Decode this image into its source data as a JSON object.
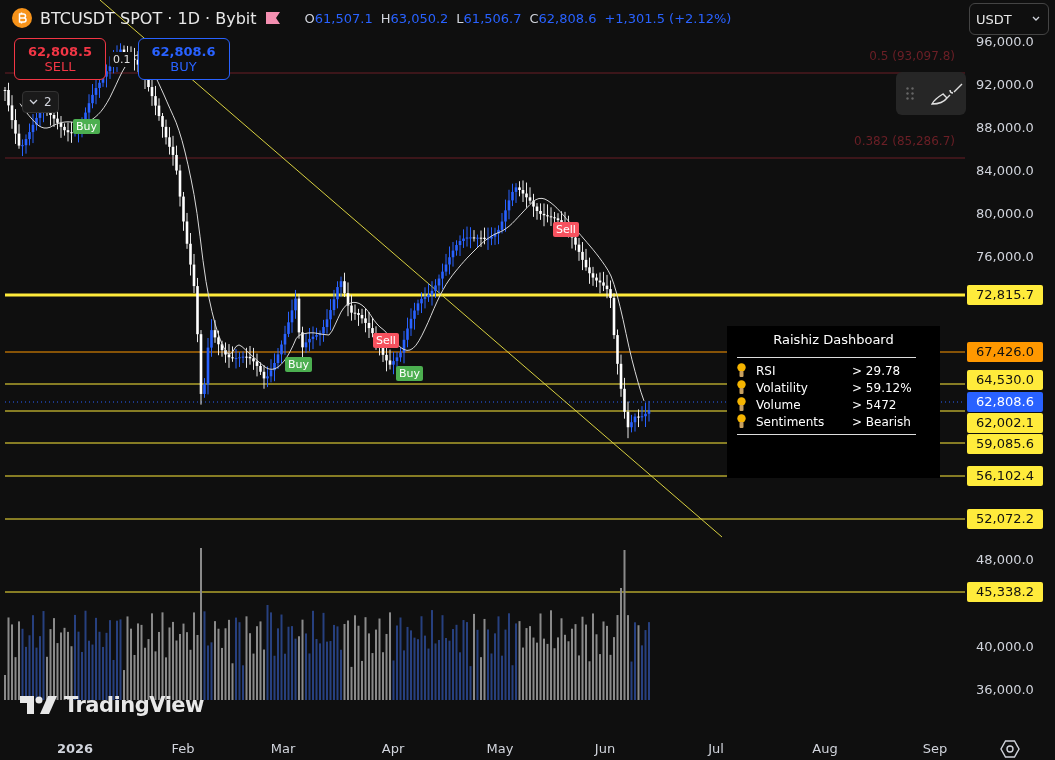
{
  "header": {
    "symbol": "BTCUSDT SPOT · 1D · Bybit",
    "ohlc": [
      {
        "key": "O",
        "value": "61,507.1"
      },
      {
        "key": "H",
        "value": "63,050.2"
      },
      {
        "key": "L",
        "value": "61,506.7"
      },
      {
        "key": "C",
        "value": "62,808.6"
      }
    ],
    "change": "+1,301.5 (+2.12%)"
  },
  "currency_select": {
    "value": "USDT"
  },
  "trade_buttons": [
    {
      "kind": "sell",
      "price": "62,808.5",
      "label": "SELL"
    },
    {
      "kind": "buy",
      "price": "62,808.6",
      "label": "BUY"
    }
  ],
  "quantity": "0.1",
  "indicator_toggle": {
    "count": "2"
  },
  "fib_levels": [
    {
      "label": "0.5 (93,097.8)"
    },
    {
      "label": "0.382 (85,286.7)"
    }
  ],
  "signals": [
    {
      "kind": "buy",
      "label": "Buy"
    },
    {
      "kind": "buy",
      "label": "Buy"
    },
    {
      "kind": "sell",
      "label": "Sell"
    },
    {
      "kind": "buy",
      "label": "Buy"
    },
    {
      "kind": "sell",
      "label": "Sell"
    }
  ],
  "price_scale": [
    "96,000.0",
    "92,000.0",
    "88,000.0",
    "84,000.0",
    "80,000.0",
    "76,000.0",
    "48,000.0",
    "40,000.0",
    "36,000.0"
  ],
  "levels": [
    {
      "label": "72,815.7",
      "kind": "thick",
      "color": "#ffeb3b"
    },
    {
      "label": "67,426.0",
      "kind": "line",
      "color": "#ff9800"
    },
    {
      "label": "64,530.0",
      "kind": "line",
      "color": "#ffeb3b"
    },
    {
      "label": "62,808.6",
      "kind": "current",
      "color": "#2962ff"
    },
    {
      "label": "62,002.1",
      "kind": "line",
      "color": "#ffeb3b"
    },
    {
      "label": "59,085.6",
      "kind": "line",
      "color": "#ffeb3b"
    },
    {
      "label": "56,102.4",
      "kind": "line",
      "color": "#ffeb3b"
    },
    {
      "label": "52,072.2",
      "kind": "line",
      "color": "#ffeb3b"
    },
    {
      "label": "45,338.2",
      "kind": "line",
      "color": "#ffeb3b"
    }
  ],
  "dashboard": {
    "title": "Raishiz Dashboard",
    "rows": [
      {
        "label": "RSI",
        "value": "> 29.78"
      },
      {
        "label": "Volatility",
        "value": "> 59.12%"
      },
      {
        "label": "Volume",
        "value": "> 5472"
      },
      {
        "label": "Sentiments",
        "value": "> Bearish"
      }
    ]
  },
  "logo": "TradingView",
  "time_axis": [
    {
      "label": "2026",
      "kind": "year"
    },
    {
      "label": "Feb",
      "kind": "month"
    },
    {
      "label": "Mar",
      "kind": "month"
    },
    {
      "label": "Apr",
      "kind": "month"
    },
    {
      "label": "May",
      "kind": "month"
    },
    {
      "label": "Jun",
      "kind": "month"
    },
    {
      "label": "Jul",
      "kind": "month"
    },
    {
      "label": "Aug",
      "kind": "month"
    },
    {
      "label": "Sep",
      "kind": "month"
    }
  ]
}
